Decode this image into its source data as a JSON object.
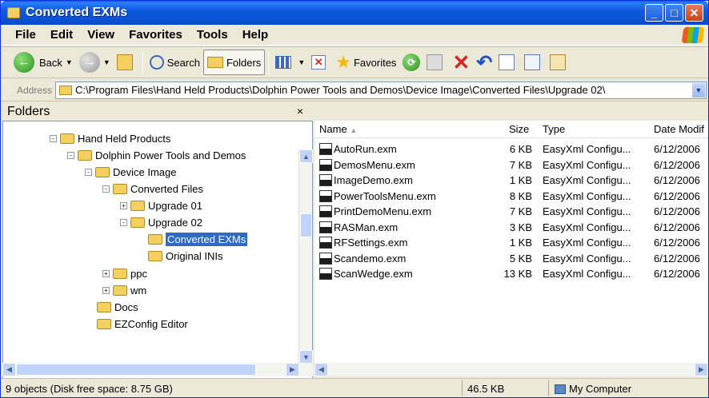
{
  "window": {
    "title": "Converted EXMs",
    "min": "_",
    "max": "□",
    "close": "✕"
  },
  "menu": [
    "File",
    "Edit",
    "View",
    "Favorites",
    "Tools",
    "Help"
  ],
  "toolbar": {
    "back": "Back",
    "search": "Search",
    "folders": "Folders",
    "favorites": "Favorites"
  },
  "address": {
    "label": "Address",
    "value": "C:\\Program Files\\Hand Held Products\\Dolphin Power Tools and Demos\\Device Image\\Converted Files\\Upgrade 02\\"
  },
  "folders": {
    "title": "Folders",
    "close": "×",
    "tree": [
      {
        "label": "Hand Held Products",
        "exp": "-"
      },
      {
        "label": "Dolphin Power Tools and Demos",
        "exp": "-"
      },
      {
        "label": "Device Image",
        "exp": "-"
      },
      {
        "label": "Converted Files",
        "exp": "-"
      },
      {
        "label": "Upgrade 01",
        "exp": "+"
      },
      {
        "label": "Upgrade 02",
        "exp": "-"
      },
      {
        "label": "Converted EXMs",
        "exp": "",
        "selected": true
      },
      {
        "label": "Original INIs",
        "exp": ""
      },
      {
        "label": "ppc",
        "exp": "+"
      },
      {
        "label": "wm",
        "exp": "+"
      },
      {
        "label": "Docs",
        "exp": ""
      },
      {
        "label": "EZConfig Editor",
        "exp": ""
      }
    ]
  },
  "list": {
    "headers": {
      "name": "Name",
      "size": "Size",
      "type": "Type",
      "date": "Date Modif"
    },
    "rows": [
      {
        "name": "AutoRun.exm",
        "size": "6 KB",
        "type": "EasyXml Configu...",
        "date": "6/12/2006"
      },
      {
        "name": "DemosMenu.exm",
        "size": "7 KB",
        "type": "EasyXml Configu...",
        "date": "6/12/2006"
      },
      {
        "name": "ImageDemo.exm",
        "size": "1 KB",
        "type": "EasyXml Configu...",
        "date": "6/12/2006"
      },
      {
        "name": "PowerToolsMenu.exm",
        "size": "8 KB",
        "type": "EasyXml Configu...",
        "date": "6/12/2006"
      },
      {
        "name": "PrintDemoMenu.exm",
        "size": "7 KB",
        "type": "EasyXml Configu...",
        "date": "6/12/2006"
      },
      {
        "name": "RASMan.exm",
        "size": "3 KB",
        "type": "EasyXml Configu...",
        "date": "6/12/2006"
      },
      {
        "name": "RFSettings.exm",
        "size": "1 KB",
        "type": "EasyXml Configu...",
        "date": "6/12/2006"
      },
      {
        "name": "Scandemo.exm",
        "size": "5 KB",
        "type": "EasyXml Configu...",
        "date": "6/12/2006"
      },
      {
        "name": "ScanWedge.exm",
        "size": "13 KB",
        "type": "EasyXml Configu...",
        "date": "6/12/2006"
      }
    ]
  },
  "status": {
    "objects": "9 objects (Disk free space: 8.75 GB)",
    "size": "46.5 KB",
    "location": "My Computer"
  }
}
